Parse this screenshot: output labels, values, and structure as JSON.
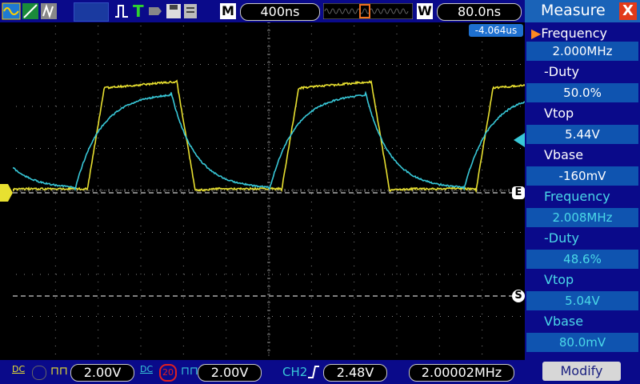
{
  "topbar": {
    "timebase": "400ns",
    "mode_letter": "M",
    "trigger_mode": "T",
    "window_letter": "W",
    "delay": "80.0ns"
  },
  "screen": {
    "cursor_readout": "-4.064us",
    "ch1_color": "#e8e030",
    "ch2_color": "#38c8d8",
    "markers": {
      "trigger": "E",
      "stop": "S"
    }
  },
  "bottombar": {
    "ch1_scale": "2.00V",
    "ch2_scale": "2.00V",
    "trigger_source": "CH2",
    "trigger_level": "2.48V",
    "frequency": "2.00002MHz",
    "ch1_coupling": "DC",
    "ch2_coupling": "DC",
    "bw_limit": "20"
  },
  "measure": {
    "title": "Measure",
    "close": "X",
    "items": [
      {
        "label": "Frequency",
        "value": "2.000MHz"
      },
      {
        "label": "-Duty",
        "value": "50.0%"
      },
      {
        "label": "Vtop",
        "value": "5.44V"
      },
      {
        "label": "Vbase",
        "value": "-160mV"
      },
      {
        "label": "Frequency",
        "value": "2.008MHz"
      },
      {
        "label": "-Duty",
        "value": "48.6%"
      },
      {
        "label": "Vtop",
        "value": "5.04V"
      },
      {
        "label": "Vbase",
        "value": "80.0mV"
      }
    ],
    "modify": "Modify"
  }
}
